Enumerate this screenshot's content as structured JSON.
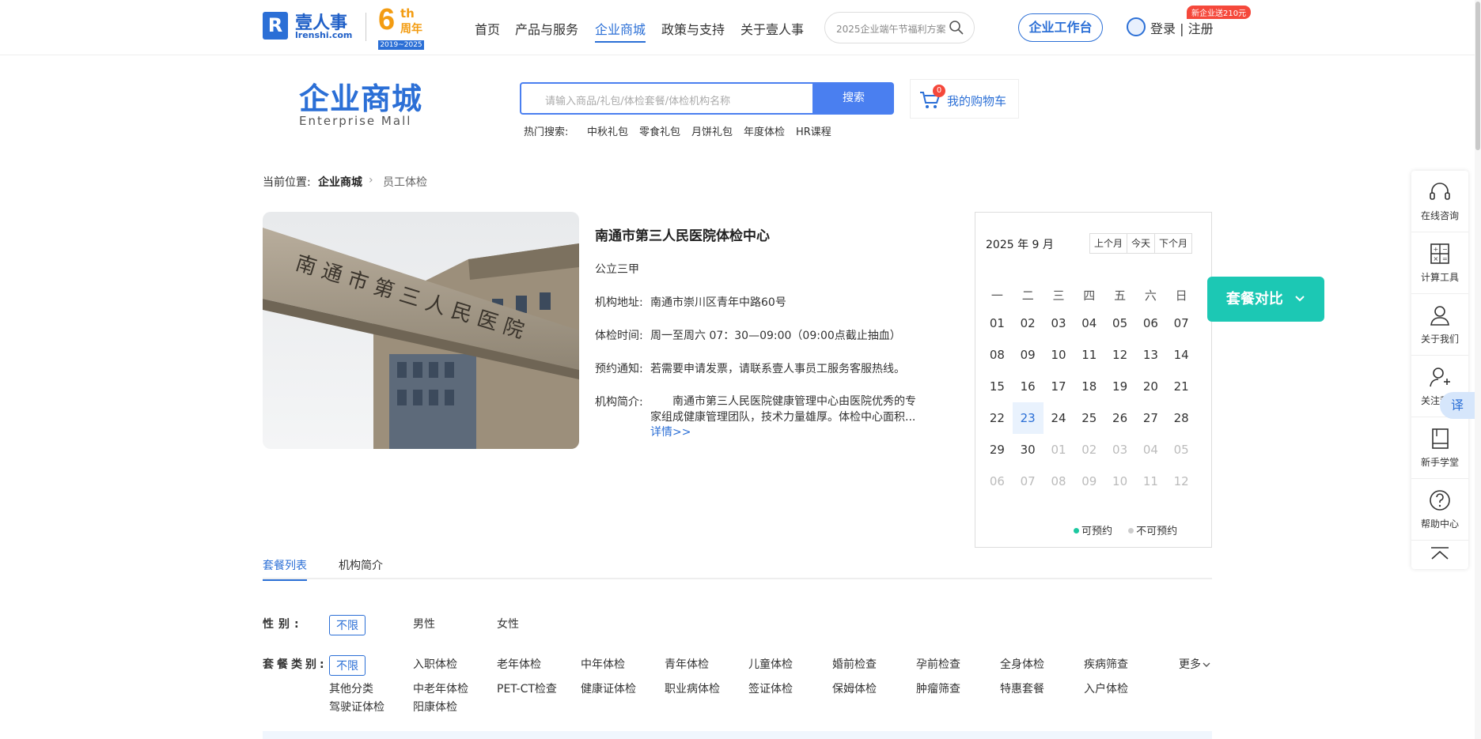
{
  "header": {
    "logo_mark": "R",
    "logo_text": "壹人事",
    "logo_domain": "lrenshi.com",
    "anniversary": {
      "num": "6",
      "suffix": "th",
      "label": "周年",
      "years": "2019~2025"
    },
    "nav": [
      "首页",
      "产品与服务",
      "企业商城",
      "政策与支持",
      "关于壹人事"
    ],
    "nav_active": "企业商城",
    "search_placeholder": "2025企业端午节福利方案",
    "workbench": "企业工作台",
    "login": "登录 | 注册",
    "promo_badge": "新企业送210元"
  },
  "mall": {
    "title": "企业商城",
    "subtitle": "Enterprise Mall",
    "search_placeholder": "请输入商品/礼包/体检套餐/体检机构名称",
    "search_button": "搜索",
    "cart_count": "0",
    "cart_label": "我的购物车",
    "hot_label": "热门搜索:",
    "hot_items": [
      "中秋礼包",
      "零食礼包",
      "月饼礼包",
      "年度体检",
      "HR课程"
    ]
  },
  "breadcrumb": {
    "prefix": "当前位置:",
    "level1": "企业商城",
    "sep": "›",
    "current": "员工体检"
  },
  "hospital": {
    "name": "南通市第三人民医院体检中心",
    "grade": "公立三甲",
    "address_label": "机构地址:",
    "address": "南通市崇川区青年中路60号",
    "hours_label": "体检时间:",
    "hours": "周一至周六 07：30—09:00（09:00点截止抽血）",
    "notice_label": "预约通知:",
    "notice": "若需要申请发票，请联系壹人事员工服务客服热线。",
    "intro_label": "机构简介:",
    "intro": "南通市第三人民医院健康管理中心由医院优秀的专家组成健康管理团队，技术力量雄厚。体检中心面积...",
    "more": "详情>>"
  },
  "calendar": {
    "title": "2025 年 9 月",
    "buttons": [
      "上个月",
      "今天",
      "下个月"
    ],
    "weekdays": [
      "一",
      "二",
      "三",
      "四",
      "五",
      "六",
      "日"
    ],
    "days": [
      "01",
      "02",
      "03",
      "04",
      "05",
      "06",
      "07",
      "08",
      "09",
      "10",
      "11",
      "12",
      "13",
      "14",
      "15",
      "16",
      "17",
      "18",
      "19",
      "20",
      "21",
      "22",
      "23",
      "24",
      "25",
      "26",
      "27",
      "28",
      "29",
      "30",
      "01",
      "02",
      "03",
      "04",
      "05",
      "06",
      "07",
      "08",
      "09",
      "10",
      "11",
      "12"
    ],
    "today": "23",
    "legend_available": "可预约",
    "legend_unavailable": "不可预约",
    "available_color": "#1cc8a0",
    "unavailable_color": "#cccccc"
  },
  "compare_button": "套餐对比",
  "tabs": [
    "套餐列表",
    "机构简介"
  ],
  "filters": {
    "gender_label": "性别:",
    "gender_options": [
      "不限",
      "男性",
      "女性"
    ],
    "category_label": "套餐类别:",
    "category_row1": [
      "不限",
      "入职体检",
      "老年体检",
      "中年体检",
      "青年体检",
      "儿童体检",
      "婚前检查",
      "孕前检查",
      "全身体检",
      "疾病筛查"
    ],
    "category_row2": [
      "其他分类",
      "中老年体检",
      "PET-CT检查",
      "健康证体检",
      "职业病体检",
      "签证体检",
      "保姆体检",
      "肿瘤筛查",
      "特惠套餐",
      "入户体检"
    ],
    "category_row3": [
      "驾驶证体检",
      "阳康体检"
    ],
    "more": "更多"
  },
  "sidebar": {
    "items": [
      "在线咨询",
      "计算工具",
      "关于我们",
      "关注我们",
      "新手学堂",
      "帮助中心"
    ],
    "translate": "译"
  },
  "colors": {
    "brand": "#2b6fd6",
    "accent_teal": "#1cc8b4",
    "promo_red": "#f5483b"
  }
}
